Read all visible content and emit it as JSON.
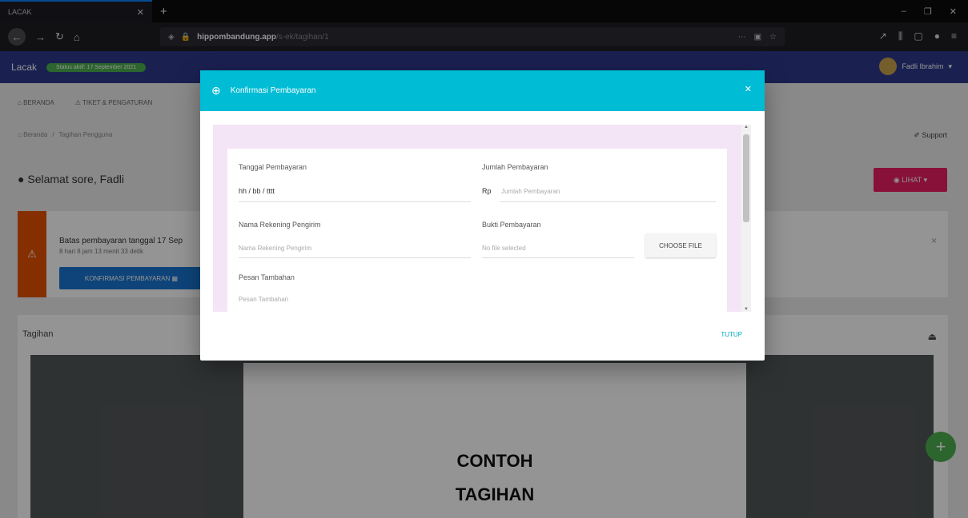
{
  "browser": {
    "tab_title": "LACAK",
    "url_host": "hippombandung.app",
    "url_path": "/s-ek/tagihan/1"
  },
  "app": {
    "logo": "Lacak",
    "badge": "Status aktif: 17 September 2021",
    "user_name": "Fadli Ibrahim"
  },
  "subnav": {
    "items": [
      "BERANDA",
      "TIKET & PENGATURAN"
    ]
  },
  "breadcrumb": {
    "home": "Beranda",
    "current": "Tagihan Pengguna"
  },
  "support_label": "Support",
  "greeting": "Selamat sore, Fadli",
  "lihat_label": "LIHAT",
  "alert": {
    "title": "Batas pembayaran tanggal 17 Sep",
    "sub": "8 hari 8 jam 13 menit 33 detik",
    "button": "KONFIRMASI PEMBAYARAN"
  },
  "tagihan": {
    "title": "Tagihan",
    "doc_lines": [
      "CONTOH",
      "TAGIHAN"
    ]
  },
  "modal": {
    "title": "Konfirmasi Pembayaran",
    "fields": {
      "tanggal_label": "Tanggal Pembayaran",
      "tanggal_value": "hh / bb / tttt",
      "jumlah_label": "Jumlah Pembayaran",
      "jumlah_prefix": "Rp",
      "jumlah_placeholder": "Jumlah Pembayaran",
      "nama_label": "Nama Rekening Pengirim",
      "nama_placeholder": "Nama Rekening Pengirim",
      "bukti_label": "Bukti Pembayaran",
      "bukti_value": "No file selected",
      "choose_button": "CHOOSE FILE",
      "pesan_label": "Pesan Tambahan",
      "pesan_placeholder": "Pesan Tambahan"
    },
    "close_button": "TUTUP"
  }
}
